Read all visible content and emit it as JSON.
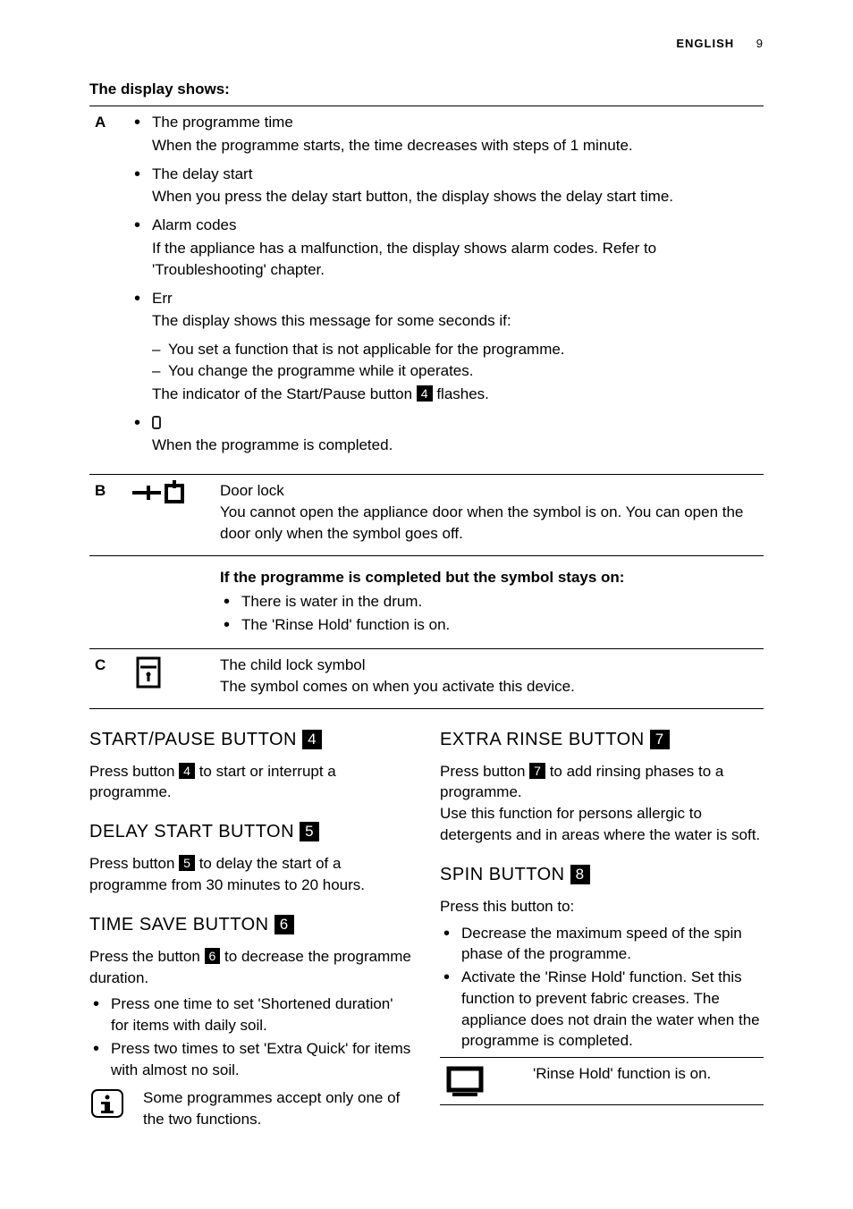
{
  "header": {
    "lang": "ENGLISH",
    "page": "9"
  },
  "display_heading": "The display shows:",
  "rowA": {
    "label": "A",
    "items": [
      {
        "title": "The programme time",
        "desc": "When the programme starts, the time decreases with steps of 1 minute."
      },
      {
        "title": "The delay start",
        "desc": "When you press the delay start button, the display shows the delay start time."
      },
      {
        "title": "Alarm codes",
        "desc": "If the appliance has a malfunction, the display shows alarm codes. Refer to 'Troubleshooting' chapter."
      },
      {
        "title": "Err",
        "desc": "The display shows this message for some seconds if:"
      }
    ],
    "err_dashes": [
      "You set a function that is not applicable for the programme.",
      "You change the programme while it operates."
    ],
    "err_post_a": "The indicator of the Start/Pause button ",
    "err_post_num": "4",
    "err_post_b": " flashes.",
    "last_item_desc": "When the programme is completed."
  },
  "rowB": {
    "label": "B",
    "title": "Door lock",
    "desc": "You cannot open the appliance door when the symbol is on. You can open the door only when the symbol goes off.",
    "bold": "If the programme is completed but the symbol stays on:",
    "bullets": [
      "There is water in the drum.",
      "The 'Rinse Hold' function is on."
    ]
  },
  "rowC": {
    "label": "C",
    "title": "The child lock symbol",
    "desc": "The symbol comes on when you activate this device."
  },
  "left": {
    "start": {
      "head": "START/PAUSE BUTTON ",
      "num": "4",
      "text_a": "Press button ",
      "text_num": "4",
      "text_b": " to start or interrupt a programme."
    },
    "delay": {
      "head": "DELAY START BUTTON ",
      "num": "5",
      "text_a": "Press button ",
      "text_num": "5",
      "text_b": " to delay the start of a programme from 30 minutes to 20 hours."
    },
    "timesave": {
      "head": "TIME SAVE BUTTON ",
      "num": "6",
      "text_a": "Press the button ",
      "text_num": "6",
      "text_b": " to decrease the programme duration.",
      "bullets": [
        "Press one time to set 'Shortened duration' for items with daily soil.",
        "Press two times to set 'Extra Quick' for items with almost no soil."
      ],
      "note": "Some programmes accept only one of the two functions."
    }
  },
  "right": {
    "extra": {
      "head": "EXTRA RINSE BUTTON ",
      "num": "7",
      "text_a": "Press button ",
      "text_num": "7",
      "text_b": " to add rinsing phases to a programme.",
      "text_c": "Use this function for persons allergic to detergents and in areas where the water is soft."
    },
    "spin": {
      "head": "SPIN BUTTON ",
      "num": "8",
      "lead": "Press this button to:",
      "bullets": [
        "Decrease the maximum speed of the spin phase of the programme.",
        "Activate the 'Rinse Hold' function. Set this function to prevent fabric creases. The appliance does not drain the water when the programme is completed."
      ],
      "rinse_text": "'Rinse Hold' function is on."
    }
  }
}
